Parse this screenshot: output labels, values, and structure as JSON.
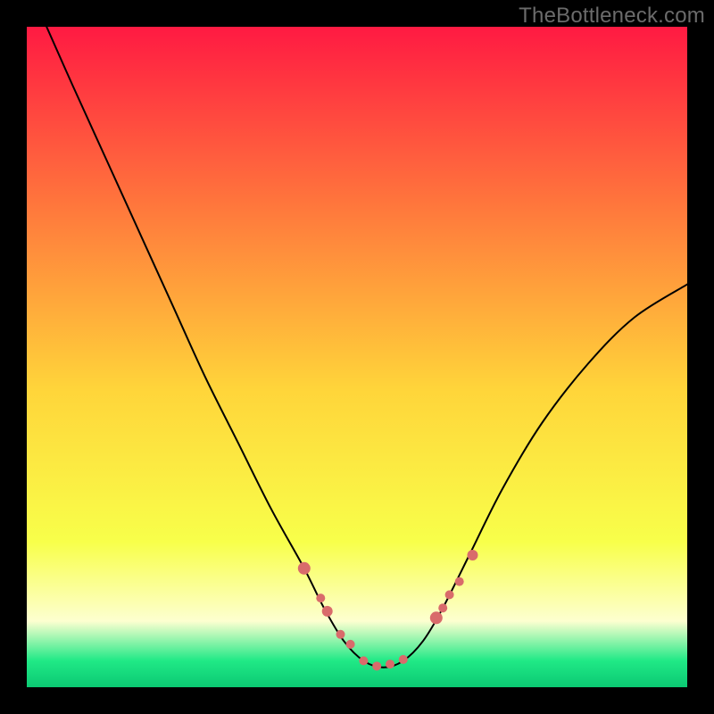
{
  "watermark": "TheBottleneck.com",
  "gradient": {
    "top": "#ff1a42",
    "upper_mid": "#ff7a3c",
    "mid": "#ffd53a",
    "lower_mid": "#f8ff4a",
    "pale": "#fdffd0",
    "bottom": "#20e986",
    "deep_bottom": "#0bc973"
  },
  "chart_data": {
    "type": "line",
    "title": "",
    "xlabel": "",
    "ylabel": "",
    "xlim": [
      0,
      100
    ],
    "ylim": [
      0,
      100
    ],
    "series": [
      {
        "name": "bottleneck-curve",
        "x": [
          3,
          7,
          12,
          17,
          22,
          27,
          32,
          37,
          42,
          45,
          48,
          51,
          54,
          57,
          60,
          63,
          67,
          72,
          78,
          85,
          92,
          100
        ],
        "y": [
          100,
          91,
          80,
          69,
          58,
          47,
          37,
          27,
          18,
          12,
          7,
          4,
          3,
          4,
          7,
          12,
          20,
          30,
          40,
          49,
          56,
          61
        ]
      }
    ],
    "markers": {
      "name": "highlight-points",
      "x": [
        42,
        44.5,
        45.5,
        47.5,
        49,
        51,
        53,
        55,
        57,
        62,
        63,
        64,
        65.5,
        67.5
      ],
      "y": [
        18,
        13.5,
        11.5,
        8,
        6.5,
        4,
        3.2,
        3.5,
        4.2,
        10.5,
        12,
        14,
        16,
        20
      ],
      "r": [
        7,
        5,
        6,
        5,
        5,
        5,
        5,
        5,
        5,
        7,
        5,
        5,
        5,
        6
      ]
    }
  }
}
